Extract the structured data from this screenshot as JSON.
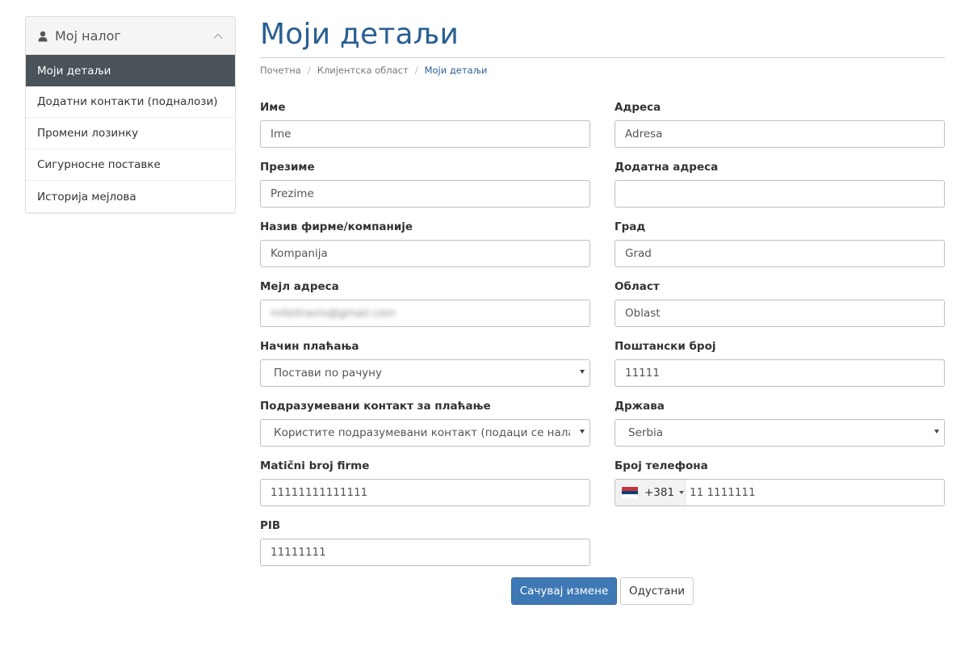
{
  "sidebar": {
    "title": "Мој налог",
    "items": [
      {
        "label": "Моји детаљи",
        "active": true
      },
      {
        "label": "Додатни контакти (подналози)"
      },
      {
        "label": "Промени лозинку"
      },
      {
        "label": "Сигурносне поставке"
      },
      {
        "label": "Историја мејлова"
      }
    ]
  },
  "header": {
    "title": "Моји детаљи",
    "breadcrumb": [
      "Почетна",
      "Клијентска област",
      "Моји детаљи"
    ]
  },
  "form": {
    "first_name": {
      "label": "Име",
      "value": "Ime"
    },
    "last_name": {
      "label": "Презиме",
      "value": "Prezime"
    },
    "company": {
      "label": "Назив фирме/компаније",
      "value": "Kompanija"
    },
    "email": {
      "label": "Мејл адреса",
      "value": "mileitravis@gmail.com"
    },
    "payment_method": {
      "label": "Начин плаћања",
      "value": "Постави по рачуну"
    },
    "billing_contact": {
      "label": "Подразумевани контакт за плаћање",
      "value": "Користите подразумевани контакт (подаци се налазе"
    },
    "reg_number": {
      "label": "Matični broj firme",
      "value": "11111111111111"
    },
    "pib": {
      "label": "PIB",
      "value": "11111111"
    },
    "address": {
      "label": "Адреса",
      "value": "Adresa"
    },
    "address2": {
      "label": "Додатна адреса",
      "value": ""
    },
    "city": {
      "label": "Град",
      "value": "Grad"
    },
    "region": {
      "label": "Област",
      "value": "Oblast"
    },
    "postcode": {
      "label": "Поштански број",
      "value": "11111"
    },
    "country": {
      "label": "Држава",
      "value": "Serbia"
    },
    "phone": {
      "label": "Број телефона",
      "dial_code": "+381",
      "value": "11 1111111"
    }
  },
  "buttons": {
    "save": "Сачувај измене",
    "cancel": "Одустани"
  },
  "colors": {
    "accent": "#2a5f93",
    "primary_button": "#3f79b5",
    "active_sidebar": "#4a5358"
  },
  "icons": {
    "sidebar_head": "user-icon",
    "sidebar_toggle": "chevron-up-icon",
    "phone_flag": "serbia-flag-icon"
  }
}
